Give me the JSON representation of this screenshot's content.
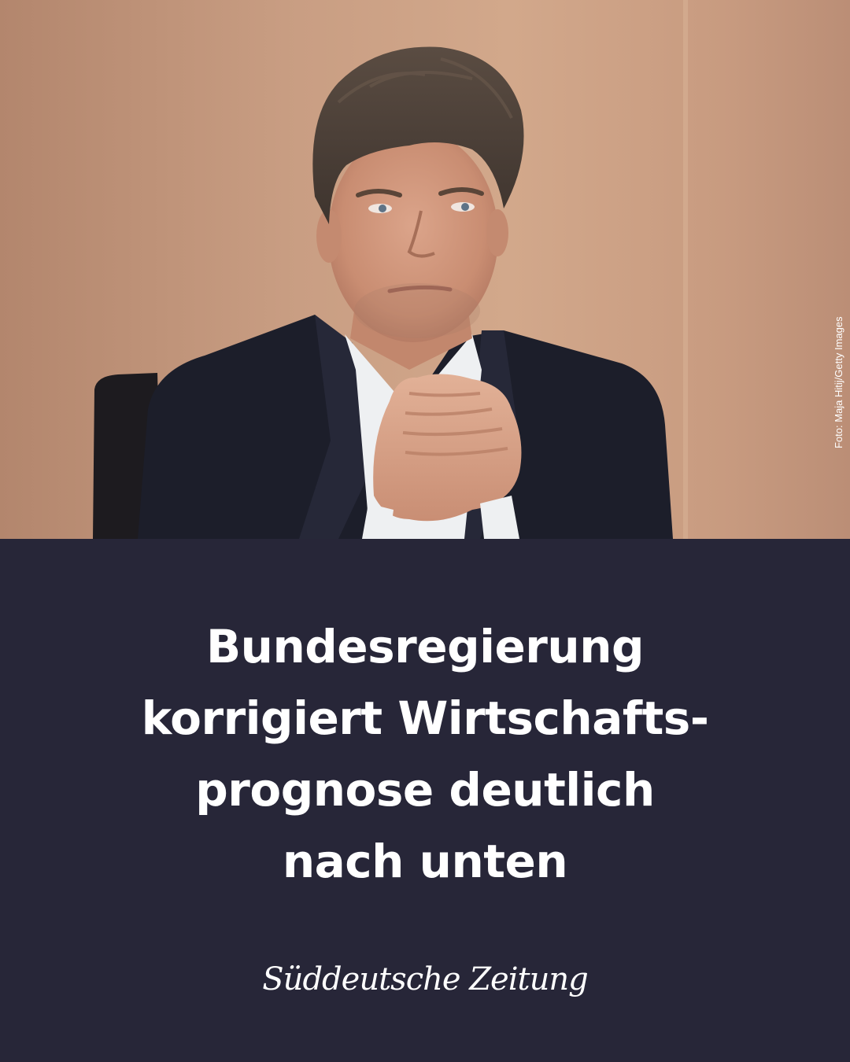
{
  "photo": {
    "credit": "Foto: Maja Hitij/Getty Images"
  },
  "headline": {
    "lines": [
      "Bundesregierung",
      "korrigiert Wirtschafts-",
      "prognose deutlich",
      "nach unten"
    ]
  },
  "brand": {
    "logo_text": "Süddeutsche Zeitung"
  },
  "colors": {
    "panel_background": "#272638",
    "headline_text": "#ffffff",
    "photo_wall": "#c89c80",
    "jacket": "#1c1e2a"
  }
}
